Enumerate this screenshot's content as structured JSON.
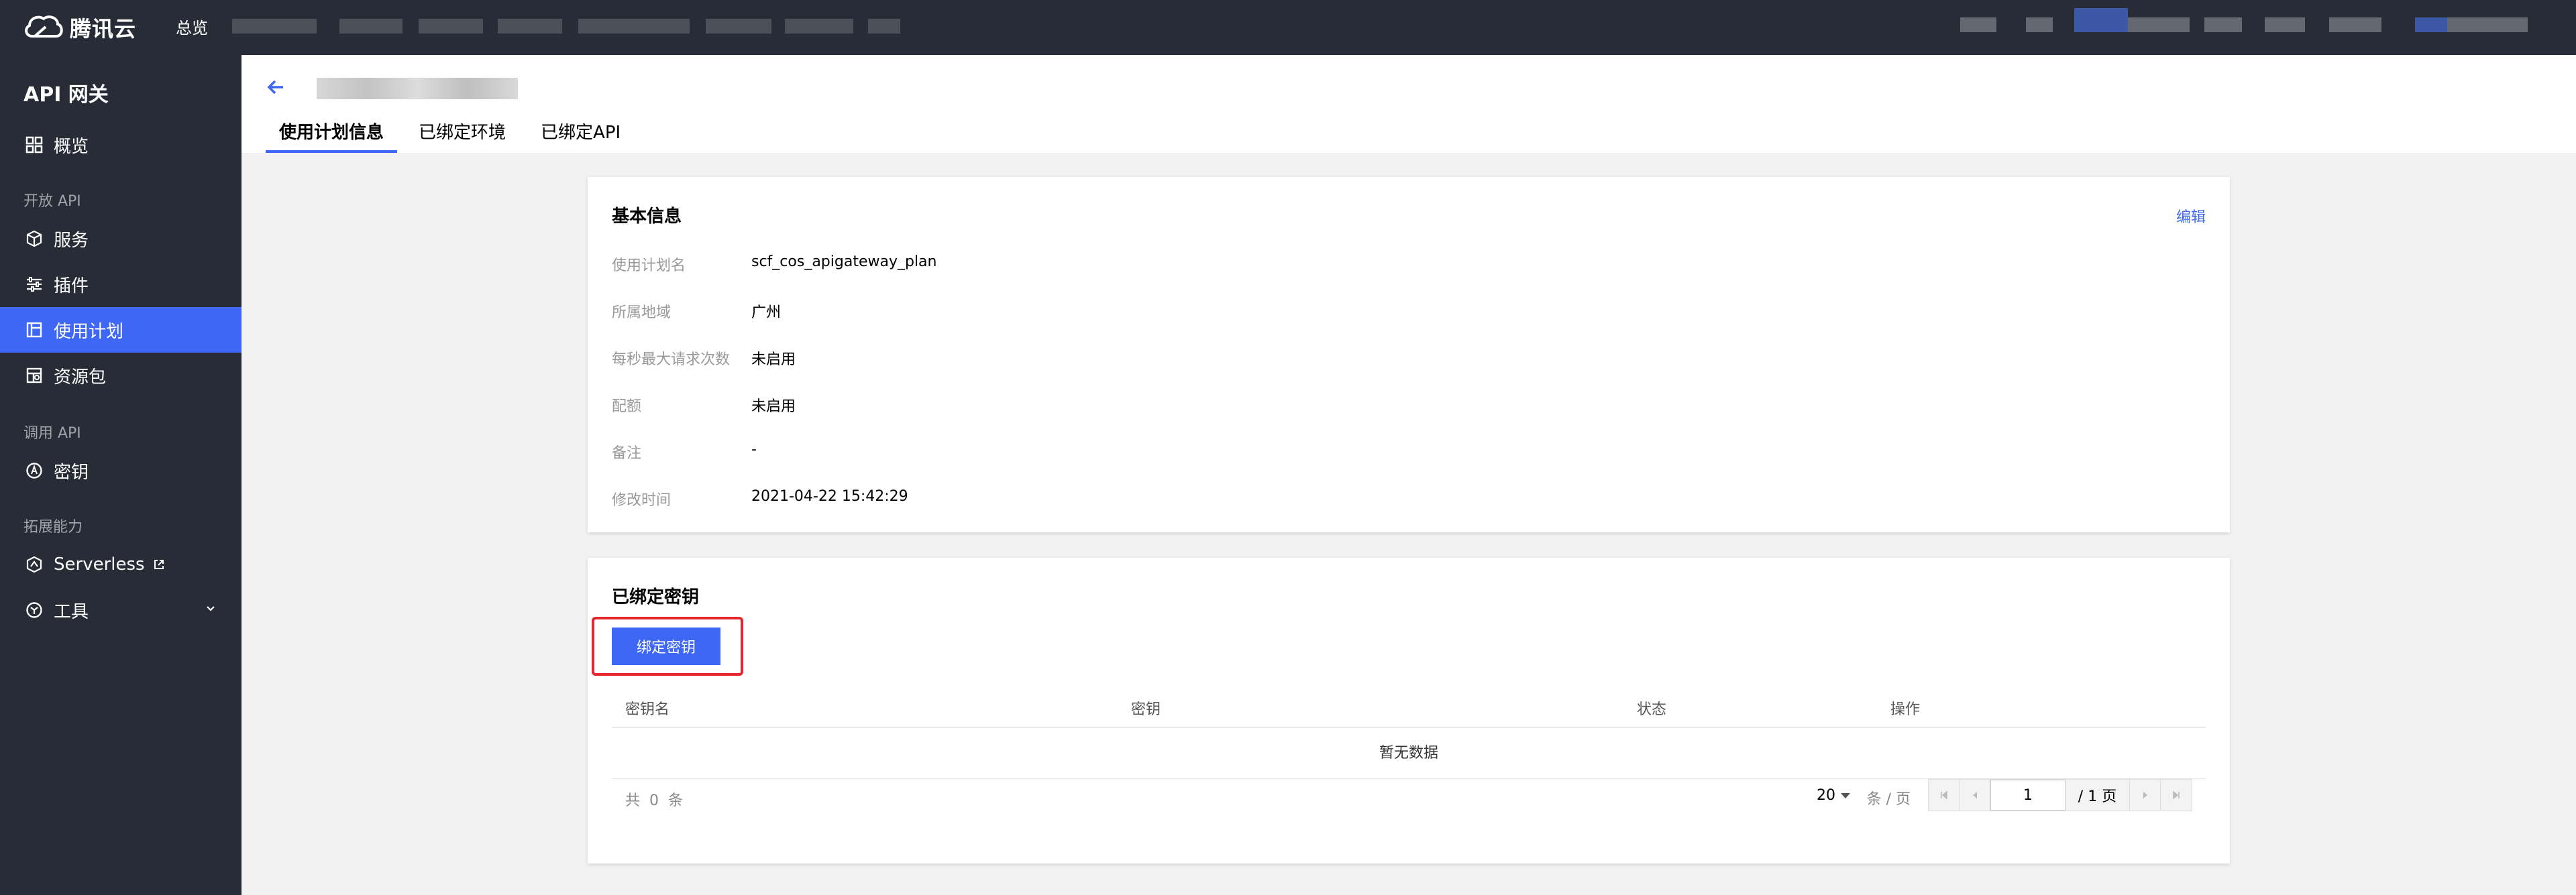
{
  "topbar": {
    "brand": "腾讯云",
    "nav_overview": "总览"
  },
  "sidebar": {
    "title": "API 网关",
    "items": [
      {
        "label": "概览",
        "icon": "dashboard-icon"
      },
      {
        "label": "服务",
        "icon": "cube-icon"
      },
      {
        "label": "插件",
        "icon": "sliders-icon"
      },
      {
        "label": "使用计划",
        "icon": "plan-icon",
        "active": true
      },
      {
        "label": "资源包",
        "icon": "package-icon"
      },
      {
        "label": "密钥",
        "icon": "key-icon"
      },
      {
        "label": "Serverless",
        "icon": "serverless-icon",
        "external": true
      },
      {
        "label": "工具",
        "icon": "tools-icon",
        "expandable": true
      }
    ],
    "sections": [
      "开放 API",
      "调用 API",
      "拓展能力"
    ]
  },
  "header": {
    "tabs": [
      "使用计划信息",
      "已绑定环境",
      "已绑定API"
    ],
    "active_tab": 0
  },
  "basic_info": {
    "title": "基本信息",
    "edit_label": "编辑",
    "rows": [
      {
        "key": "使用计划名",
        "value": "scf_cos_apigateway_plan"
      },
      {
        "key": "所属地域",
        "value": "广州"
      },
      {
        "key": "每秒最大请求次数",
        "value": "未启用"
      },
      {
        "key": "配额",
        "value": "未启用"
      },
      {
        "key": "备注",
        "value": "-"
      },
      {
        "key": "修改时间",
        "value": "2021-04-22 15:42:29"
      }
    ]
  },
  "bound_keys": {
    "title": "已绑定密钥",
    "bind_button": "绑定密钥",
    "columns": [
      "密钥名",
      "密钥",
      "状态",
      "操作"
    ],
    "empty_text": "暂无数据",
    "total_text": "共  0  条",
    "page_size": "20",
    "per_page_label": "条 / 页",
    "page_input": "1",
    "page_total": "/ 1 页"
  },
  "colors": {
    "topbar_bg": "#272c36",
    "accent": "#3e67f6",
    "highlight": "#e5262c"
  }
}
